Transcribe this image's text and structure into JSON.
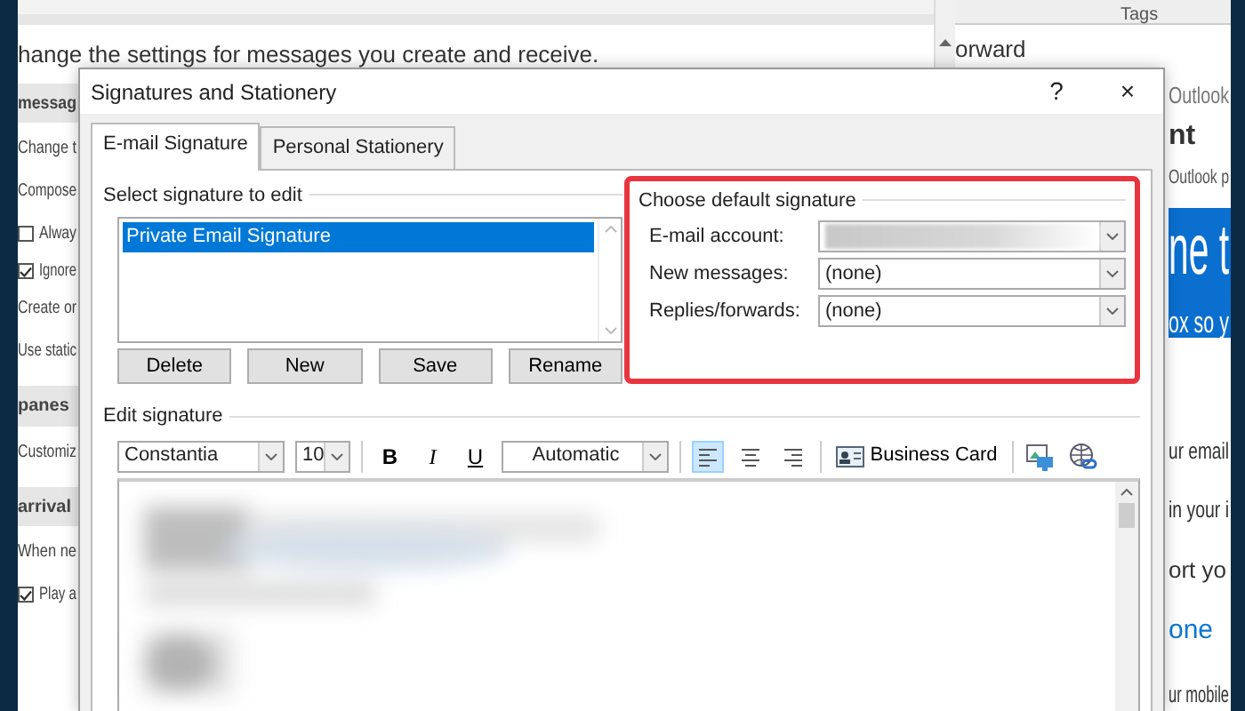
{
  "background": {
    "intro": "hange the settings for messages you create and receive.",
    "column_header": "Tags",
    "left_items": [
      {
        "kind": "heading",
        "text": "messag"
      },
      {
        "kind": "text",
        "text": "Change t"
      },
      {
        "kind": "text",
        "text": "Compose"
      },
      {
        "kind": "checkbox",
        "text": "Alway",
        "checked": false
      },
      {
        "kind": "checkbox",
        "text": "Ignore",
        "checked": true
      },
      {
        "kind": "text",
        "text": "Create or"
      },
      {
        "kind": "text",
        "text": "Use static"
      },
      {
        "kind": "heading",
        "text": "panes"
      },
      {
        "kind": "text",
        "text": "Customiz"
      },
      {
        "kind": "heading",
        "text": "arrival"
      },
      {
        "kind": "text",
        "text": "When ne"
      },
      {
        "kind": "checkbox",
        "text": "Play a",
        "checked": true
      }
    ],
    "right_items": [
      {
        "kind": "text",
        "text": "orward"
      },
      {
        "kind": "muted",
        "text": "Outlook"
      },
      {
        "kind": "heading",
        "text": "nt"
      },
      {
        "kind": "small",
        "text": "Outlook p"
      },
      {
        "kind": "banner",
        "lines": [
          "ne t",
          "ox so y"
        ]
      },
      {
        "kind": "text",
        "text": "ur email"
      },
      {
        "kind": "text",
        "text": "in your i"
      },
      {
        "kind": "text",
        "text": "ort yo"
      },
      {
        "kind": "link",
        "text": "one"
      },
      {
        "kind": "text",
        "text": "ur mobile"
      }
    ]
  },
  "dialog": {
    "title": "Signatures and Stationery",
    "help": "?",
    "close": "×",
    "tabs": [
      {
        "label": "E-mail Signature",
        "selected": true
      },
      {
        "label": "Personal Stationery",
        "selected": false
      }
    ],
    "select_group": {
      "label": "Select signature to edit",
      "items": [
        {
          "label": "Private Email Signature",
          "selected": true
        }
      ],
      "buttons": [
        "Delete",
        "New",
        "Save",
        "Rename"
      ]
    },
    "default_group": {
      "label": "Choose default signature",
      "highlighted": true,
      "fields": [
        {
          "label": "E-mail account:",
          "redacted": true
        },
        {
          "label": "New messages:",
          "value": "(none)"
        },
        {
          "label": "Replies/forwards:",
          "value": "(none)"
        }
      ]
    },
    "edit_group": {
      "label": "Edit signature",
      "font": "Constantia",
      "size": "10",
      "styles": [
        {
          "kind": "bold",
          "label": "B"
        },
        {
          "kind": "italic",
          "label": "I"
        },
        {
          "kind": "underline",
          "label": "U"
        }
      ],
      "color_picker": "Automatic",
      "alignments": [
        {
          "kind": "left",
          "selected": true
        },
        {
          "kind": "center",
          "selected": false
        },
        {
          "kind": "right",
          "selected": false
        }
      ],
      "business_card": "Business Card",
      "redacted": true
    }
  }
}
